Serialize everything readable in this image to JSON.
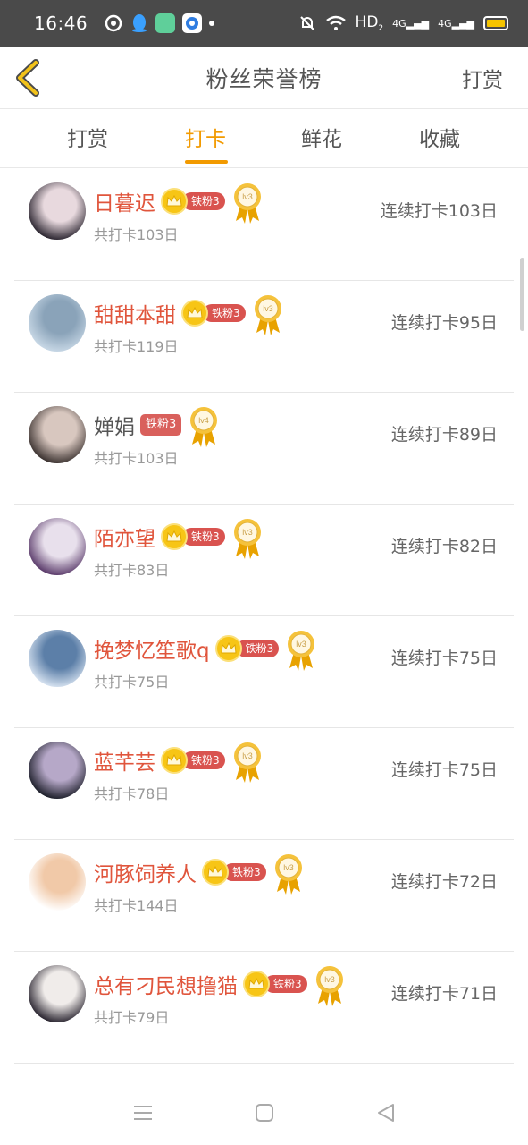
{
  "status_bar": {
    "time": "16:46",
    "network": "HD",
    "network_sub": "2",
    "signal1": "4G",
    "signal2": "4G"
  },
  "header": {
    "title": "粉丝荣誉榜",
    "action": "打赏"
  },
  "tabs": [
    {
      "label": "打赏",
      "active": false
    },
    {
      "label": "打卡",
      "active": true
    },
    {
      "label": "鲜花",
      "active": false
    },
    {
      "label": "收藏",
      "active": false
    }
  ],
  "users": [
    {
      "name": "日暮迟",
      "badge": "铁粉3",
      "level": "lv3",
      "total": "共打卡103日",
      "streak": "连续打卡103日",
      "crown": true,
      "highlight": true
    },
    {
      "name": "甜甜本甜",
      "badge": "铁粉3",
      "level": "lv3",
      "total": "共打卡119日",
      "streak": "连续打卡95日",
      "crown": true,
      "highlight": true
    },
    {
      "name": "婵娟",
      "badge": "铁粉3",
      "level": "lv4",
      "total": "共打卡103日",
      "streak": "连续打卡89日",
      "crown": false,
      "highlight": false
    },
    {
      "name": "陌亦望",
      "badge": "铁粉3",
      "level": "lv3",
      "total": "共打卡83日",
      "streak": "连续打卡82日",
      "crown": true,
      "highlight": true
    },
    {
      "name": "挽梦忆笙歌q",
      "badge": "铁粉3",
      "level": "lv3",
      "total": "共打卡75日",
      "streak": "连续打卡75日",
      "crown": true,
      "highlight": true
    },
    {
      "name": "蓝芊芸",
      "badge": "铁粉3",
      "level": "lv3",
      "total": "共打卡78日",
      "streak": "连续打卡75日",
      "crown": true,
      "highlight": true
    },
    {
      "name": "河豚饲养人",
      "badge": "铁粉3",
      "level": "lv3",
      "total": "共打卡144日",
      "streak": "连续打卡72日",
      "crown": true,
      "highlight": true
    },
    {
      "name": "总有刁民想撸猫",
      "badge": "铁粉3",
      "level": "lv3",
      "total": "共打卡79日",
      "streak": "连续打卡71日",
      "crown": true,
      "highlight": true
    }
  ],
  "colors": {
    "accent": "#f29a00",
    "name_red": "#e0553c",
    "badge_red": "#d9534f",
    "gold": "#f7c516"
  }
}
